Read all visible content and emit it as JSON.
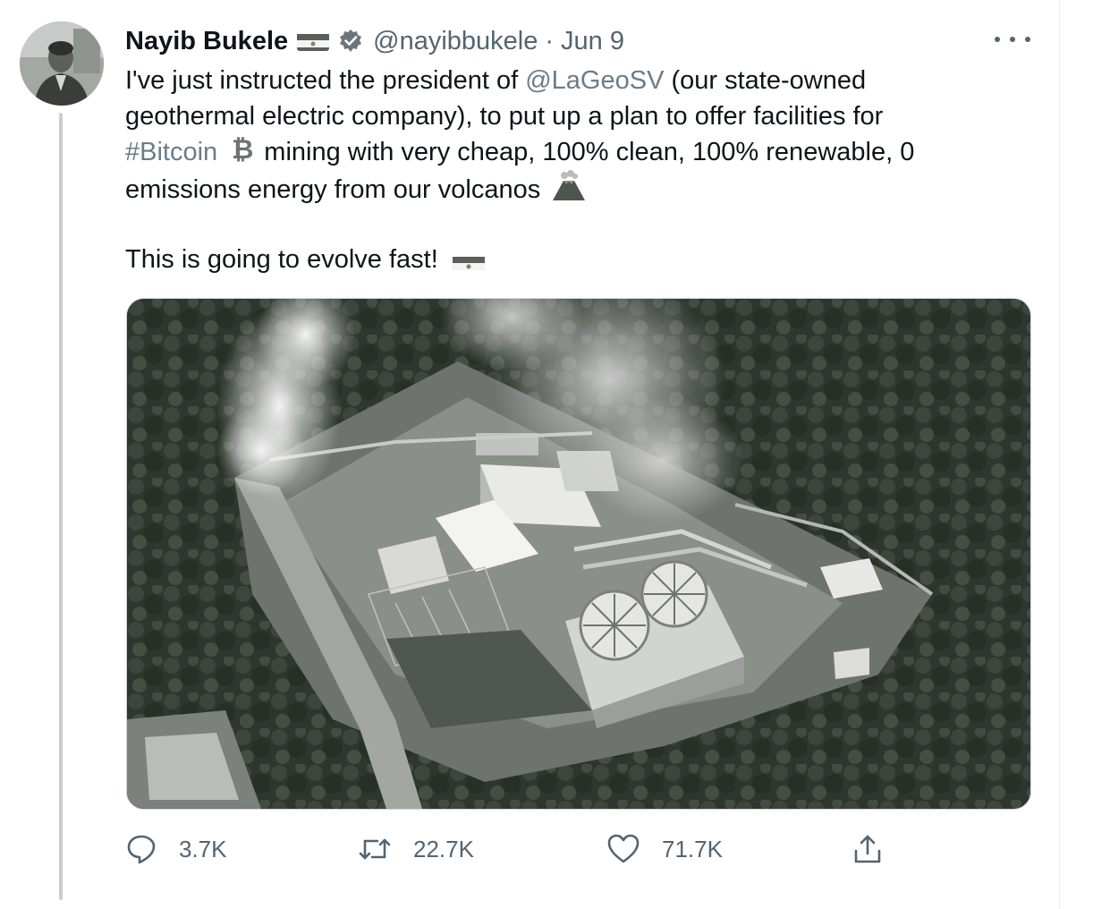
{
  "tweet": {
    "author": {
      "name": "Nayib Bukele",
      "handle": "@nayibbukele",
      "date": "Jun 9"
    },
    "text": {
      "line1_pre": "I've just instructed the president of ",
      "mention": "@LaGeoSV",
      "line1_post": " (our state-owned",
      "line2": "geothermal electric company), to put up a plan to offer facilities for",
      "hashtag": "#Bitcoin",
      "line3_post": " mining with very cheap, 100% clean, 100% renewable, 0",
      "line4": "emissions energy from our volcanos",
      "line5": "This is going to evolve fast!"
    },
    "media": {
      "description": "aerial-geothermal-plant-photo"
    },
    "actions": {
      "replies": "3.7K",
      "retweets": "22.7K",
      "likes": "71.7K"
    }
  },
  "icons": {
    "flag": "el-salvador-flag-icon",
    "verified": "verified-badge-icon",
    "bitcoin": "bitcoin-icon",
    "volcano": "volcano-icon",
    "reply": "reply-icon",
    "retweet": "retweet-icon",
    "like": "heart-icon",
    "share": "share-icon",
    "more": "more-dots-icon"
  },
  "colors": {
    "text": "#0f1419",
    "muted": "#536471",
    "link": "#6b7c89",
    "thread_line": "#c9ced1"
  }
}
